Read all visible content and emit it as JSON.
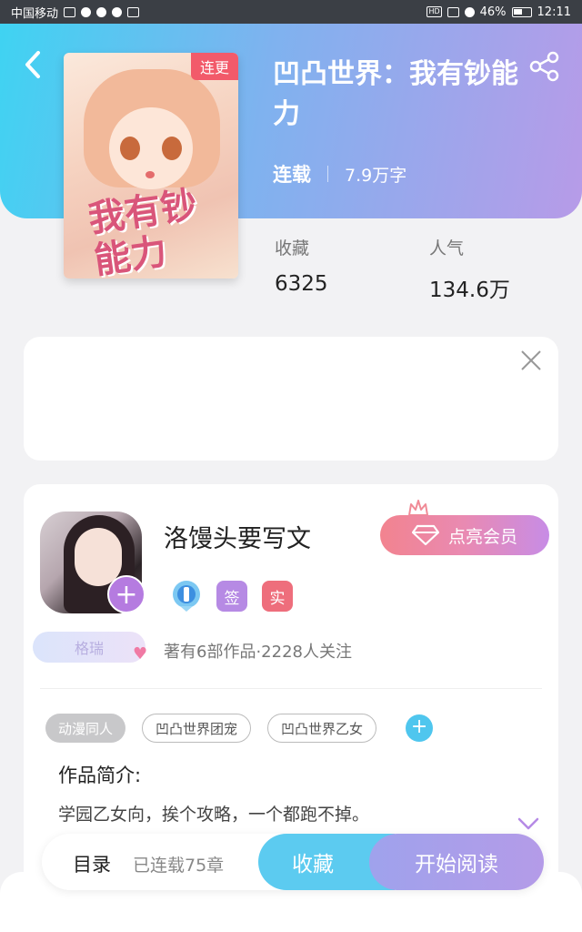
{
  "status_bar": {
    "carrier": "中国移动",
    "battery": "46%",
    "time": "12:11"
  },
  "book": {
    "title": "凹凸世界：我有钞能力",
    "cover_tag": "连更",
    "cover_title": "我有钞能力",
    "status": "连载",
    "word_count": "7.9万字",
    "favorites_label": "收藏",
    "favorites_value": "6325",
    "popularity_label": "人气",
    "popularity_value": "134.6万"
  },
  "author": {
    "name": "洛馒头要写文",
    "vip_button": "点亮会员",
    "badge_sign": "签",
    "badge_real": "实",
    "level": "格瑞",
    "works_info": "著有6部作品·2228人关注"
  },
  "tags": [
    "动漫同人",
    "凹凸世界团宠",
    "凹凸世界乙女"
  ],
  "intro": {
    "label": "作品简介:",
    "text": "学园乙女向，挨个攻略，一个都跑不掉。"
  },
  "bottom_bar": {
    "toc": "目录",
    "chapters": "已连载75章",
    "favorite": "收藏",
    "read": "开始阅读"
  },
  "colors": {
    "header_start": "#3fd3f2",
    "header_end": "#b79be8",
    "vip_pink": "#f2838f",
    "sign_purple": "#b68ae4",
    "real_red": "#ee6e7c",
    "accent_blue": "#5ccbf0"
  }
}
